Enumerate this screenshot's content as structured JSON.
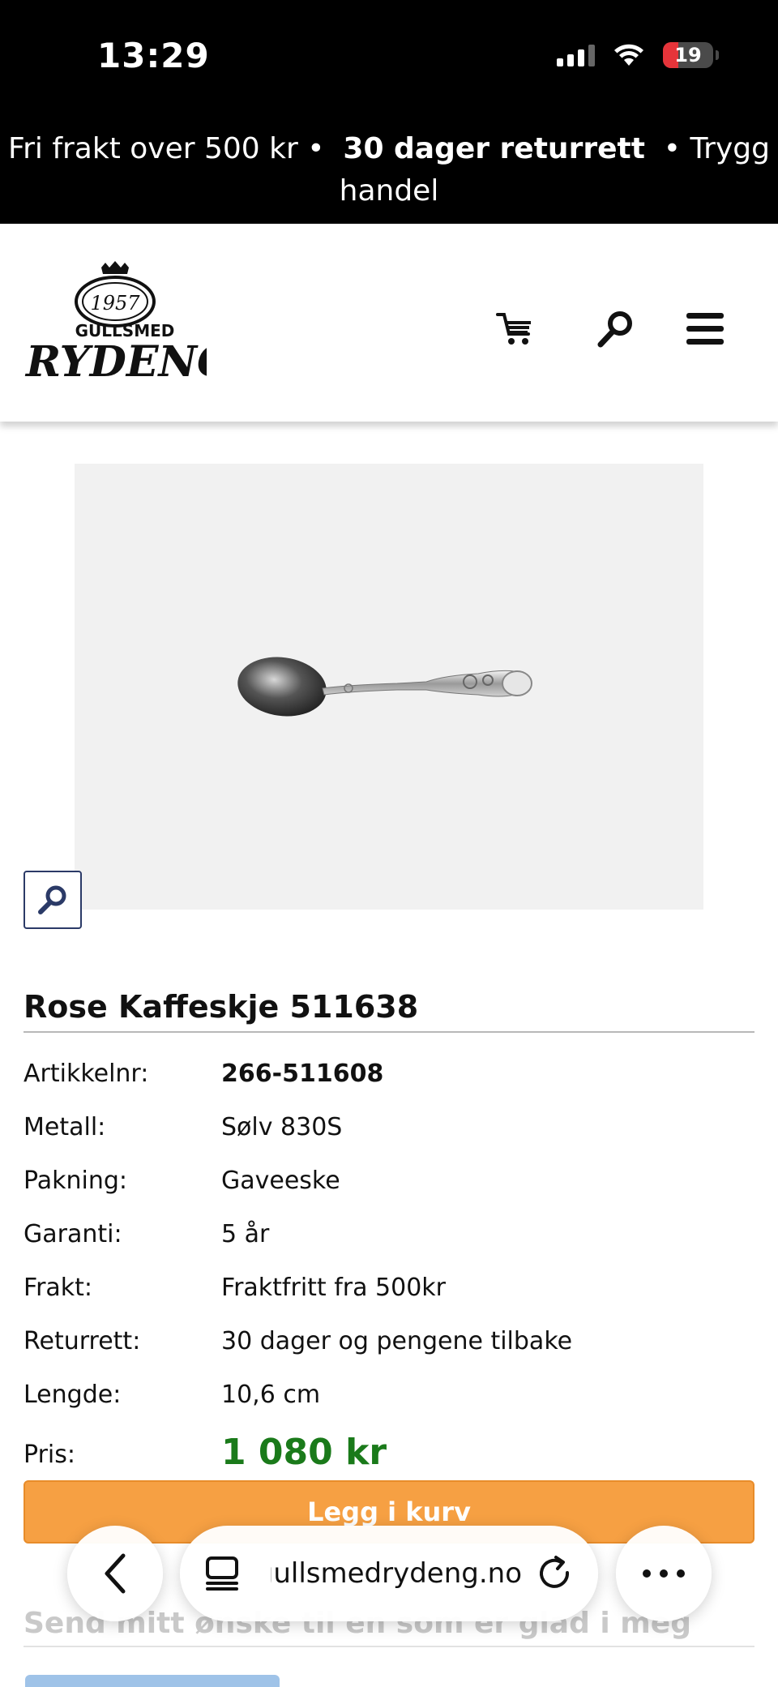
{
  "status_bar": {
    "time": "13:29",
    "battery": "19"
  },
  "promo": {
    "part1": "Fri frakt over 500 kr",
    "part2": "30 dager returrett",
    "part3": "Trygg handel",
    "separator": "•"
  },
  "header": {
    "logo_year": "1957",
    "logo_line1": "GULLSMED",
    "logo_line2": "RYDENG",
    "icons": [
      "cart-icon",
      "search-icon",
      "menu-icon"
    ]
  },
  "product": {
    "title": "Rose Kaffeskje 511638",
    "specs": [
      {
        "label": "Artikkelnr:",
        "value": "266-511608"
      },
      {
        "label": "Metall:",
        "value": "Sølv 830S"
      },
      {
        "label": "Pakning:",
        "value": "Gaveeske"
      },
      {
        "label": "Garanti:",
        "value": "5 år"
      },
      {
        "label": "Frakt:",
        "value": "Fraktfritt fra 500kr"
      },
      {
        "label": "Returrett:",
        "value": "30 dager og pengene tilbake"
      },
      {
        "label": "Lengde:",
        "value": "10,6 cm"
      }
    ],
    "price_label": "Pris:",
    "price": "1 080 kr",
    "add_to_cart": "Legg i kurv",
    "wish_text": "Send mitt ønske til en som er glad i meg"
  },
  "browser": {
    "url": "gullsmedrydeng.no"
  },
  "colors": {
    "price": "#1a7a1a",
    "cart_button": "#f6a043",
    "accent": "#2b3a67"
  }
}
